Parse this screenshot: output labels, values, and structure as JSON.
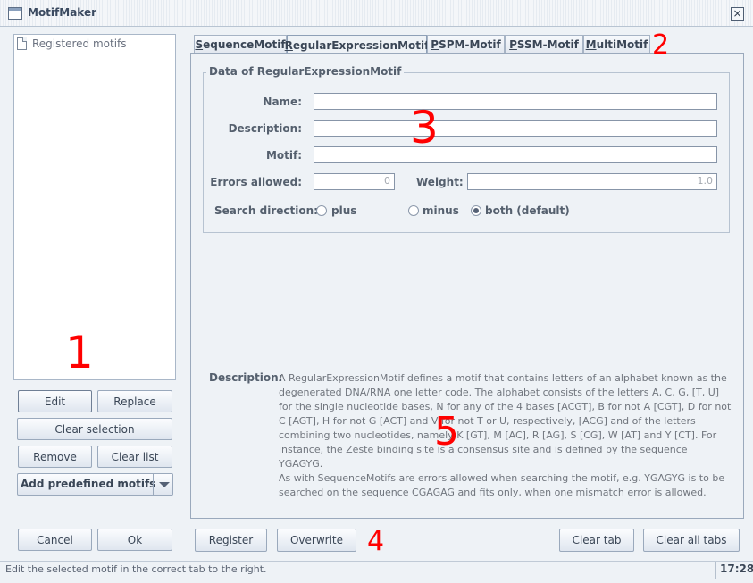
{
  "window": {
    "title": "MotifMaker",
    "close_label": "×"
  },
  "left_panel": {
    "list_root": "Registered motifs",
    "buttons": {
      "edit": "Edit",
      "replace": "Replace",
      "clear_selection": "Clear selection",
      "remove": "Remove",
      "clear_list": "Clear list",
      "cancel": "Cancel",
      "ok": "Ok"
    },
    "predefined_combo": {
      "selected": "Add predefined motifs"
    }
  },
  "tabs": [
    {
      "label": "SequenceMotif",
      "mnemonic": "S",
      "rest": "equenceMotif",
      "active": false
    },
    {
      "label": "RegularExpressionMotif",
      "mnemonic": "R",
      "rest": "egularExpressionMotif",
      "active": true
    },
    {
      "label": "PSPM-Motif",
      "mnemonic": "P",
      "rest": "SPM-Motif",
      "active": false
    },
    {
      "label": "PSSM-Motif",
      "mnemonic": "P",
      "rest": "SSM-Motif",
      "active": false
    },
    {
      "label": "MultiMotif",
      "mnemonic": "M",
      "rest": "ultiMotif",
      "active": false
    }
  ],
  "form": {
    "group_title": "Data of RegularExpressionMotif",
    "name_label": "Name:",
    "name_value": "",
    "description_label": "Description:",
    "description_value": "",
    "motif_label": "Motif:",
    "motif_value": "",
    "errors_label": "Errors allowed:",
    "errors_value": "0",
    "weight_label": "Weight:",
    "weight_value": "1.0",
    "direction_label": "Search direction:",
    "direction_options": [
      "plus",
      "minus",
      "both (default)"
    ],
    "direction_selected": "both (default)"
  },
  "help": {
    "title": "Description:",
    "paragraph1": "A RegularExpressionMotif defines a motif that contains letters of an alphabet known as the degenerated DNA/RNA one letter code. The alphabet consists of the letters A, C, G, [T, U] for the single nucleotide bases, N for any of the 4 bases [ACGT], B for not A [CGT], D for not C [AGT], H for not G [ACT] and V for not T or U, respectively, [ACG] and of the letters combining two nucleotides, namely K [GT], M [AC], R [AG], S [CG], W [AT] and Y [CT]. For instance, the Zeste binding site is a consensus site and is defined by the sequence YGAGYG.",
    "paragraph2": "As with SequenceMotifs are errors allowed when searching the motif, e.g. YGAGYG is to be searched on the sequence CGAGAG and fits only, when one mismatch error is allowed."
  },
  "bottom_buttons": {
    "register": "Register",
    "overwrite": "Overwrite",
    "clear_tab": "Clear tab",
    "clear_all_tabs": "Clear all tabs"
  },
  "status": {
    "text": "Edit the selected motif in the correct tab to the right.",
    "time": "17:28"
  },
  "annotations": [
    "1",
    "2",
    "3",
    "4",
    "5"
  ],
  "colors": {
    "annotation": "#ff0000",
    "window_bg": "#eef2f6"
  }
}
